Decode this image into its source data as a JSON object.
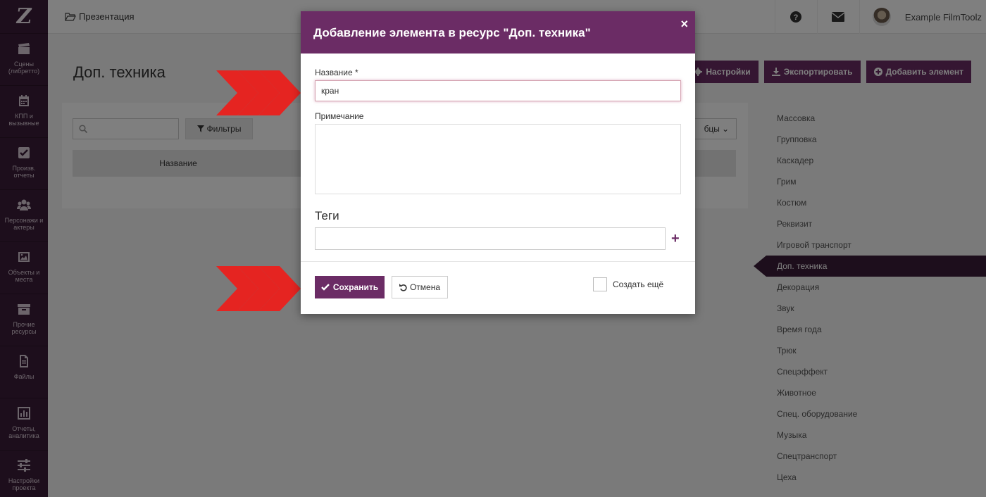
{
  "sidebar": {
    "logo": "Z",
    "items": [
      {
        "label": "Сцены (либретто)",
        "icon": "clapperboard-icon"
      },
      {
        "label": "КПП и вызывные",
        "icon": "calendar-icon"
      },
      {
        "label": "Произв. отчеты",
        "icon": "checkbox-icon"
      },
      {
        "label": "Персонажи и актеры",
        "icon": "users-icon"
      },
      {
        "label": "Объекты и места",
        "icon": "image-icon"
      },
      {
        "label": "Прочие ресурсы",
        "icon": "archive-icon"
      },
      {
        "label": "Файлы",
        "icon": "file-icon"
      },
      {
        "label": "Отчеты, аналитика",
        "icon": "bar-chart-icon"
      },
      {
        "label": "Настройки проекта",
        "icon": "sliders-icon"
      }
    ]
  },
  "topbar": {
    "breadcrumb": "Презентация",
    "username": "Example FilmToolz"
  },
  "page": {
    "title": "Доп. техника",
    "actions": {
      "settings": "Настройки",
      "export": "Экспортировать",
      "add": "Добавить элемент"
    },
    "filter_label": "Фильтры",
    "columns_label": "бцы",
    "table_header": "Название"
  },
  "resources": {
    "items": [
      "Массовка",
      "Групповка",
      "Каскадер",
      "Грим",
      "Костюм",
      "Реквизит",
      "Игровой транспорт",
      "Доп. техника",
      "Декорация",
      "Звук",
      "Время года",
      "Трюк",
      "Спецэффект",
      "Животное",
      "Спец. оборудование",
      "Музыка",
      "Спецтранспорт",
      "Цеха"
    ],
    "active_index": 7
  },
  "modal": {
    "title": "Добавление элемента в ресурс \"Доп. техника\"",
    "close": "×",
    "name_label": "Название",
    "required_mark": "*",
    "name_value": "кран",
    "note_label": "Примечание",
    "tags_label": "Теги",
    "add_tag": "+",
    "save_label": "Сохранить",
    "cancel_label": "Отмена",
    "create_more_label": "Создать ещё"
  },
  "colors": {
    "sidebar": "#3b1d38",
    "accent": "#6b2c65",
    "arrow": "#e52421"
  }
}
